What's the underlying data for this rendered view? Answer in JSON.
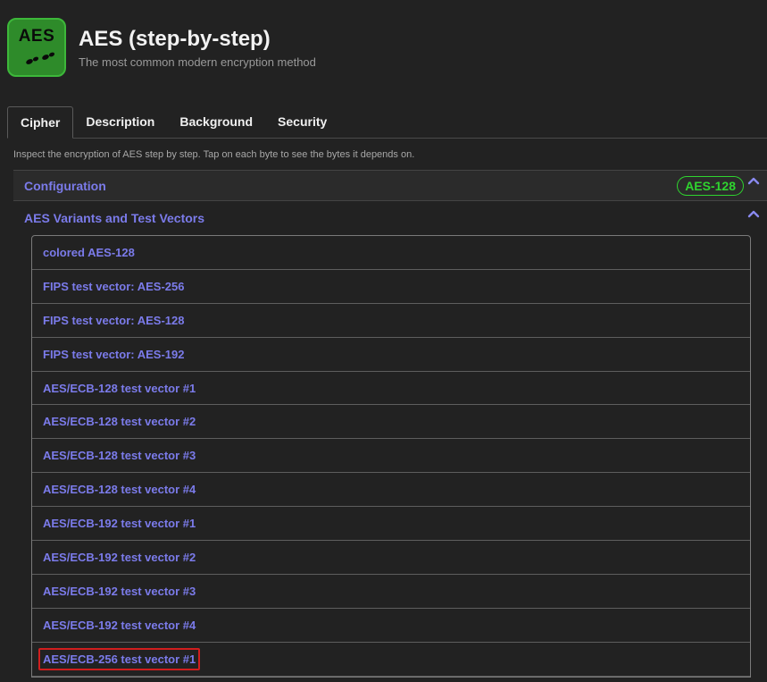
{
  "app": {
    "logo_text": "AES",
    "title": "AES (step-by-step)",
    "subtitle": "The most common modern encryption method"
  },
  "tabs": [
    {
      "label": "Cipher",
      "active": true
    },
    {
      "label": "Description",
      "active": false
    },
    {
      "label": "Background",
      "active": false
    },
    {
      "label": "Security",
      "active": false
    }
  ],
  "intro_text": "Inspect the encryption of AES step by step. Tap on each byte to see the bytes it depends on.",
  "configuration": {
    "label": "Configuration",
    "badge": "AES-128",
    "badge_color": "#2fd42f"
  },
  "variants": {
    "label": "AES Variants and Test Vectors",
    "items": [
      {
        "label": "colored AES-128"
      },
      {
        "label": "FIPS test vector: AES-256"
      },
      {
        "label": "FIPS test vector: AES-128"
      },
      {
        "label": "FIPS test vector: AES-192"
      },
      {
        "label": "AES/ECB-128 test vector #1"
      },
      {
        "label": "AES/ECB-128 test vector #2"
      },
      {
        "label": "AES/ECB-128 test vector #3"
      },
      {
        "label": "AES/ECB-128 test vector #4"
      },
      {
        "label": "AES/ECB-192 test vector #1"
      },
      {
        "label": "AES/ECB-192 test vector #2"
      },
      {
        "label": "AES/ECB-192 test vector #3"
      },
      {
        "label": "AES/ECB-192 test vector #4"
      },
      {
        "label": "AES/ECB-256 test vector #1",
        "highlighted": true
      }
    ]
  },
  "colors": {
    "accent": "#7b7bea",
    "logo_green": "#2e8b2a",
    "highlight_border": "#d11e1e"
  }
}
